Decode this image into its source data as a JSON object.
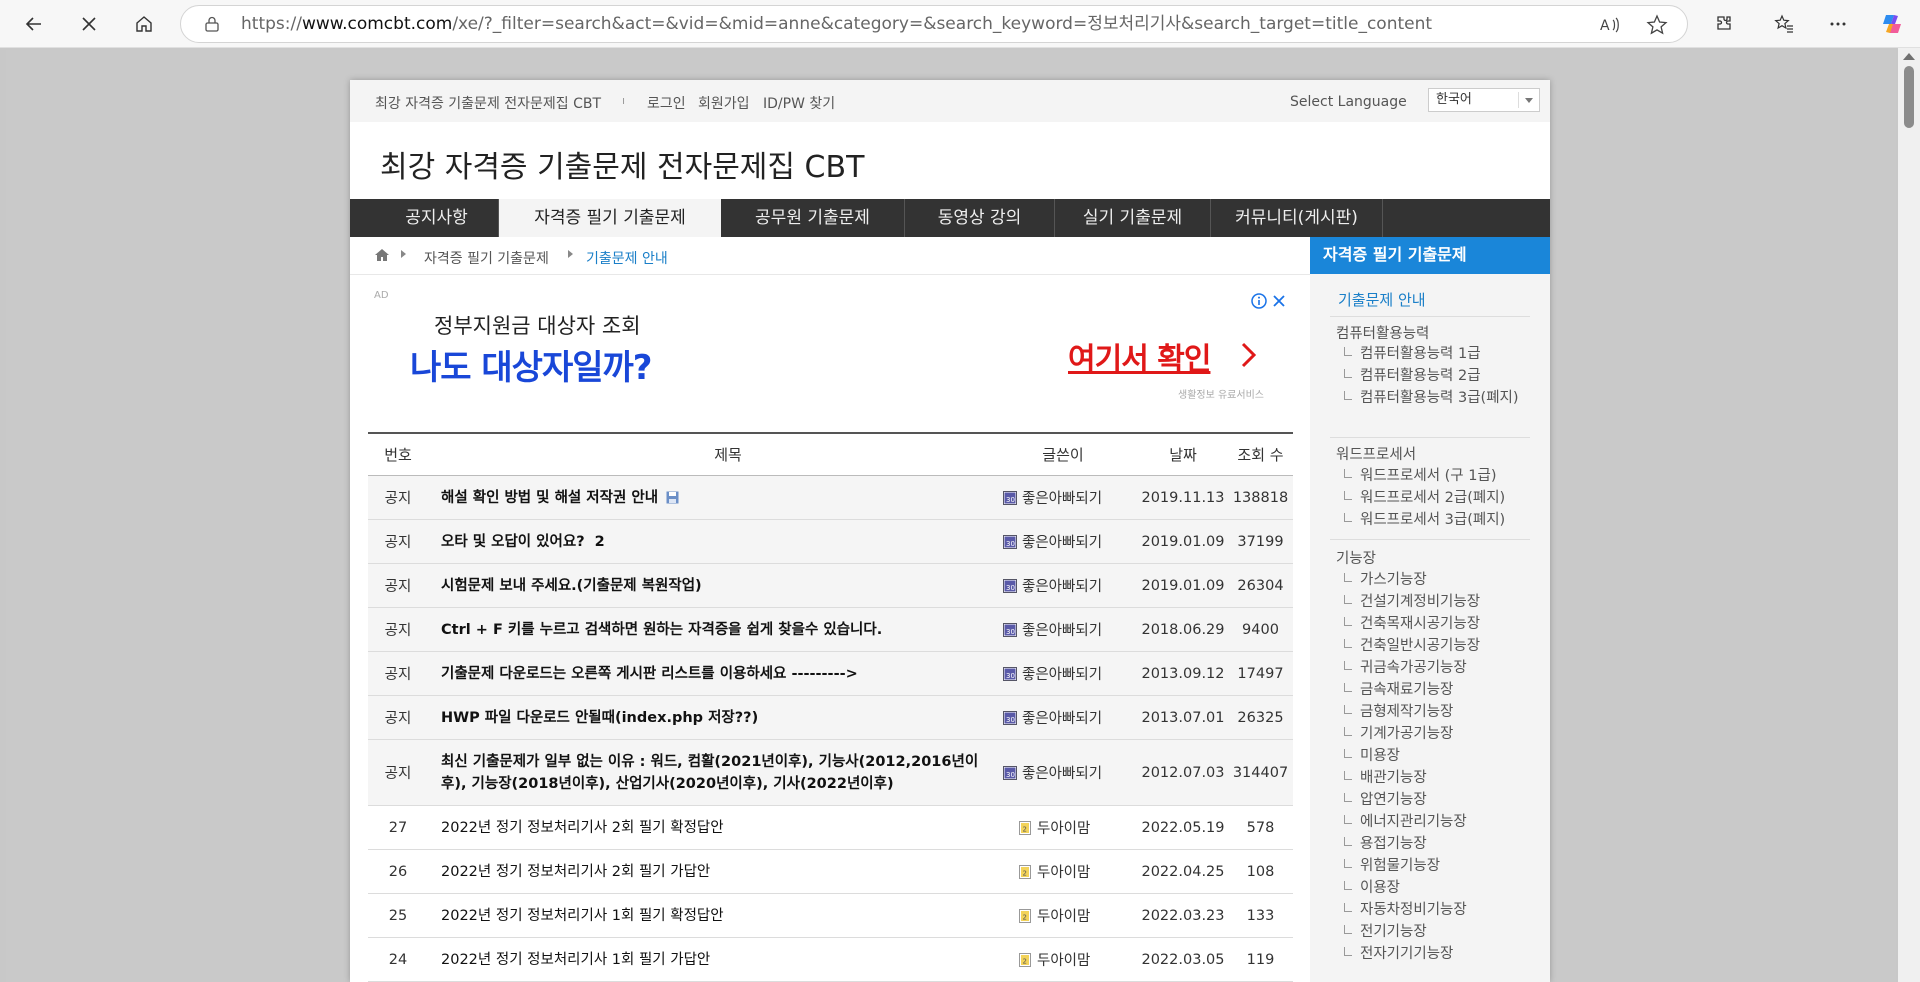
{
  "browser": {
    "url_prefix": "https://",
    "url_host": "www.comcbt.com",
    "url_rest": "/xe/?_filter=search&act=&vid=&mid=anne&category=&search_keyword=정보처리기사&search_target=title_content"
  },
  "topbar": {
    "site_name": "최강 자격증 기출문제 전자문제집 CBT",
    "separator": "ı",
    "login": "로그인",
    "signup": "회원가입",
    "find_idpw": "ID/PW 찾기",
    "lang_label": "Select Language",
    "lang_value": "한국어"
  },
  "site_title": "최강 자격증 기출문제 전자문제집 CBT",
  "gnb": [
    "공지사항",
    "자격증 필기 기출문제",
    "공무원 기출문제",
    "동영상 강의",
    "실기 기출문제",
    "커뮤니티(게시판)"
  ],
  "breadcrumb": {
    "level1": "자격증 필기 기출문제",
    "current": "기출문제 안내"
  },
  "ad": {
    "tag": "AD",
    "line1": "정부지원금 대상자 조회",
    "line2": "나도 대상자일까?",
    "cta": "여기서 확인",
    "small": "생활정보 유료서비스"
  },
  "board": {
    "headers": {
      "num": "번호",
      "title": "제목",
      "author": "글쓴이",
      "date": "날짜",
      "views": "조회 수"
    },
    "notice_label": "공지",
    "notices": [
      {
        "title": "해설 확인 방법 및 해설 저작권 안내",
        "author": "좋은아빠되기",
        "date": "2019.11.13",
        "views": "138818"
      },
      {
        "title": "오타 및 오답이 있어요?",
        "comments": "2",
        "author": "좋은아빠되기",
        "date": "2019.01.09",
        "views": "37199"
      },
      {
        "title": "시험문제 보내 주세요.(기출문제 복원작업)",
        "author": "좋은아빠되기",
        "date": "2019.01.09",
        "views": "26304"
      },
      {
        "title": "Ctrl + F 키를 누르고 검색하면 원하는 자격증을 쉽게 찾을수 있습니다.",
        "author": "좋은아빠되기",
        "date": "2018.06.29",
        "views": "9400"
      },
      {
        "title": "기출문제 다운로드는 오른쪽 게시판 리스트를 이용하세요 --------->",
        "author": "좋은아빠되기",
        "date": "2013.09.12",
        "views": "17497"
      },
      {
        "title": "HWP 파일 다운로드 안될때(index.php 저장??)",
        "author": "좋은아빠되기",
        "date": "2013.07.01",
        "views": "26325"
      },
      {
        "title": "최신 기출문제가 일부 없는 이유 : 워드, 컴활(2021년이후), 기능사(2012,2016년이후), 기능장(2018년이후), 산업기사(2020년이후), 기사(2022년이후)",
        "author": "좋은아빠되기",
        "date": "2012.07.03",
        "views": "314407"
      }
    ],
    "posts": [
      {
        "num": "27",
        "title": "2022년 정기 정보처리기사 2회 필기 확정답안",
        "author": "두아이맘",
        "date": "2022.05.19",
        "views": "578"
      },
      {
        "num": "26",
        "title": "2022년 정기 정보처리기사 2회 필기 가답안",
        "author": "두아이맘",
        "date": "2022.04.25",
        "views": "108"
      },
      {
        "num": "25",
        "title": "2022년 정기 정보처리기사 1회 필기 확정답안",
        "author": "두아이맘",
        "date": "2022.03.23",
        "views": "133"
      },
      {
        "num": "24",
        "title": "2022년 정기 정보처리기사 1회 필기 가답안",
        "author": "두아이맘",
        "date": "2022.03.05",
        "views": "119"
      }
    ]
  },
  "sidebar": {
    "head": "자격증 필기 기출문제",
    "link": "기출문제 안내",
    "groups": [
      {
        "name": "컴퓨터활용능력",
        "items": [
          "컴퓨터활용능력 1급",
          "컴퓨터활용능력 2급",
          "컴퓨터활용능력 3급(폐지)"
        ]
      },
      {
        "name": "워드프로세서",
        "items": [
          "워드프로세서 (구 1급)",
          "워드프로세서 2급(폐지)",
          "워드프로세서 3급(폐지)"
        ]
      },
      {
        "name": "기능장",
        "items": [
          "가스기능장",
          "건설기계정비기능장",
          "건축목재시공기능장",
          "건축일반시공기능장",
          "귀금속가공기능장",
          "금속재료기능장",
          "금형제작기능장",
          "기계가공기능장",
          "미용장",
          "배관기능장",
          "압연기능장",
          "에너지관리기능장",
          "용접기능장",
          "위험물기능장",
          "이용장",
          "자동차정비기능장",
          "전기기능장",
          "전자기기기능장"
        ]
      }
    ]
  },
  "colors": {
    "accent": "#1a86d9",
    "gnb_bg": "#333333",
    "ad_blue": "#1947d8",
    "ad_red": "#e01818"
  }
}
